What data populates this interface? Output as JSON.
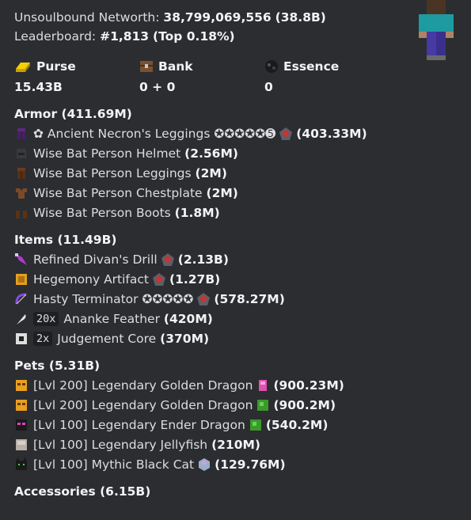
{
  "networth": {
    "label": "Unsoulbound Networth:",
    "value": "38,799,069,556",
    "short": "(38.8B)"
  },
  "leaderboard": {
    "label": "Leaderboard:",
    "rank": "#1,813",
    "top": "(Top 0.18%)"
  },
  "stats": [
    {
      "title": "Purse",
      "value": "15.43B",
      "icon": "gold-ingot-icon"
    },
    {
      "title": "Bank",
      "value": "0 + 0",
      "icon": "chest-icon"
    },
    {
      "title": "Essence",
      "value": "0",
      "icon": "wither-essence-icon"
    }
  ],
  "armor": {
    "title": "Armor (411.69M)",
    "items": [
      {
        "name": "✿ Ancient Necron's Leggings ✪✪✪✪✪➎",
        "gem": true,
        "value": "(403.33M)",
        "icon": "leggings-icon"
      },
      {
        "name": "Wise Bat Person Helmet",
        "gem": false,
        "value": "(2.56M)",
        "icon": "helmet-icon"
      },
      {
        "name": "Wise Bat Person Leggings",
        "gem": false,
        "value": "(2M)",
        "icon": "leggings-icon"
      },
      {
        "name": "Wise Bat Person Chestplate",
        "gem": false,
        "value": "(2M)",
        "icon": "chestplate-icon"
      },
      {
        "name": "Wise Bat Person Boots",
        "gem": false,
        "value": "(1.8M)",
        "icon": "boots-icon"
      }
    ]
  },
  "items": {
    "title": "Items (11.49B)",
    "entries": [
      {
        "prefix": "",
        "name": "Refined Divan's Drill",
        "gem": true,
        "value": "(2.13B)",
        "icon": "drill-icon"
      },
      {
        "prefix": "",
        "name": "Hegemony Artifact",
        "gem": true,
        "value": "(1.27B)",
        "icon": "artifact-icon"
      },
      {
        "prefix": "",
        "name": "Hasty Terminator ✪✪✪✪✪",
        "gem": true,
        "value": "(578.27M)",
        "icon": "bow-icon"
      },
      {
        "prefix": "20x",
        "name": "Ananke Feather",
        "gem": false,
        "value": "(420M)",
        "icon": "feather-icon"
      },
      {
        "prefix": "2x",
        "name": "Judgement Core",
        "gem": false,
        "value": "(370M)",
        "icon": "core-icon"
      }
    ]
  },
  "pets": {
    "title": "Pets (5.31B)",
    "entries": [
      {
        "name": "[Lvl 200] Legendary Golden Dragon",
        "item": "pet-item-icon",
        "value": "(900.23M)",
        "icon": "golden-dragon-icon"
      },
      {
        "name": "[Lvl 200] Legendary Golden Dragon",
        "item": "green-orb-icon",
        "value": "(900.2M)",
        "icon": "golden-dragon-icon"
      },
      {
        "name": "[Lvl 100] Legendary Ender Dragon",
        "item": "green-orb-icon",
        "value": "(540.2M)",
        "icon": "ender-dragon-icon"
      },
      {
        "name": "[Lvl 100] Legendary Jellyfish",
        "item": "",
        "value": "(210M)",
        "icon": "jellyfish-icon"
      },
      {
        "name": "[Lvl 100] Mythic Black Cat",
        "item": "crystal-icon",
        "value": "(129.76M)",
        "icon": "black-cat-icon"
      }
    ]
  },
  "accessories": {
    "title": "Accessories (6.15B)"
  },
  "colors": {
    "background": "#2b2d31",
    "text": "#dbdee1",
    "bold": "#f2f3f5"
  }
}
